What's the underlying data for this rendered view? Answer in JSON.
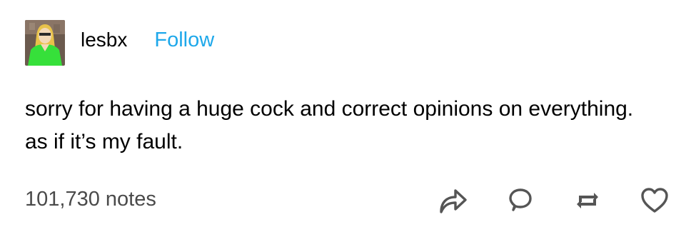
{
  "post": {
    "username": "lesbx",
    "follow_label": "Follow",
    "body_lines": [
      "sorry for having a huge cock and correct opinions on everything.",
      "as if it’s my fault."
    ],
    "notes_count": "101,730 notes"
  },
  "icons": {
    "share": "share-icon",
    "reply": "reply-icon",
    "reblog": "reblog-icon",
    "like": "heart-icon"
  },
  "colors": {
    "follow": "#1ea8ea",
    "notes": "#4a4a4a",
    "icons": "#555555"
  }
}
